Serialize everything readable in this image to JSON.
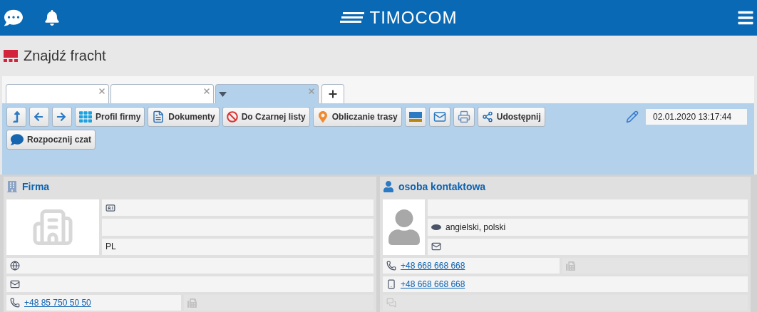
{
  "header": {
    "brand": "TIMOCOM"
  },
  "page_title": "Znajdź fracht",
  "tabs": [
    {
      "kind": "plain",
      "selected": false
    },
    {
      "kind": "plain",
      "selected": false
    },
    {
      "kind": "dropdown",
      "selected": true
    }
  ],
  "toolbar": {
    "rows": [
      [
        {
          "kind": "up"
        },
        {
          "kind": "back"
        },
        {
          "kind": "forward"
        },
        {
          "kind": "profile",
          "label": "Profil firmy"
        },
        {
          "kind": "documents",
          "label": "Dokumenty"
        },
        {
          "kind": "blacklist",
          "label": "Do Czarnej listy"
        },
        {
          "kind": "route",
          "label": "Obliczanie trasy"
        },
        {
          "kind": "pallet"
        },
        {
          "kind": "mail"
        },
        {
          "kind": "print"
        },
        {
          "kind": "share",
          "label": "Udostępnij"
        }
      ],
      [
        {
          "kind": "chat",
          "label": "Rozpocznij czat"
        }
      ]
    ],
    "timestamp": "02.01.2020 13:17:44"
  },
  "company": {
    "title": "Firma",
    "country": "PL",
    "phone": "+48 85 750 50 50"
  },
  "contact": {
    "title": "osoba kontaktowa",
    "languages": "angielski, polski",
    "phone": "+48 668 668 668",
    "mobile": "+48 668 668 668"
  }
}
